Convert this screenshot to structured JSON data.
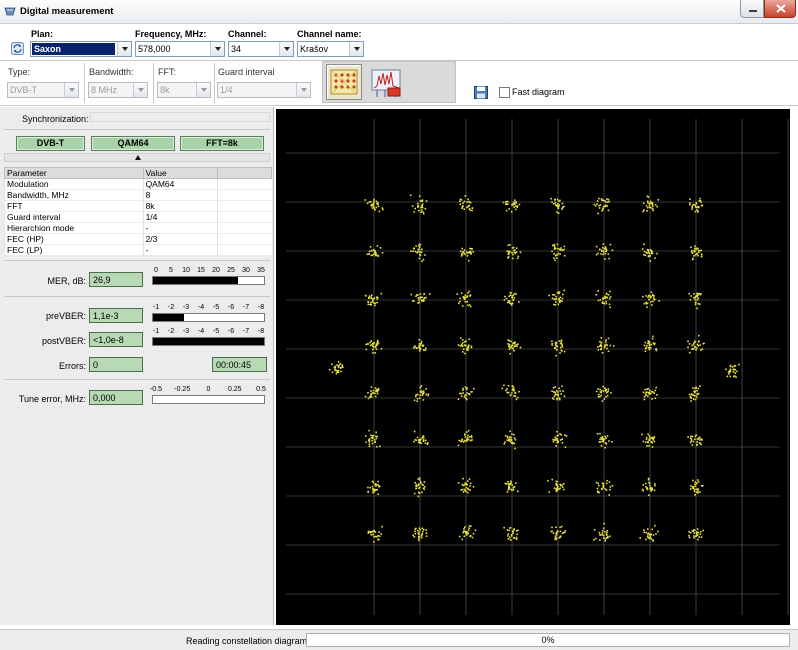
{
  "window": {
    "title": "Digital measurement"
  },
  "top": {
    "plan": {
      "label": "Plan:",
      "value": "Saxon"
    },
    "frequency": {
      "label": "Frequency,  MHz:",
      "value": "578,000"
    },
    "channel": {
      "label": "Channel:",
      "value": "34"
    },
    "channel_name": {
      "label": "Channel name:",
      "value": "Krašov"
    }
  },
  "settings": {
    "type": {
      "label": "Type:",
      "value": "DVB-T"
    },
    "bandwidth": {
      "label": "Bandwidth:",
      "value": "8 MHz"
    },
    "fft": {
      "label": "FFT:",
      "value": "8k"
    },
    "guard": {
      "label": "Guard interval",
      "value": "1/4"
    }
  },
  "fast_diagram": {
    "label": "Fast diagram",
    "checked": false
  },
  "sync": {
    "label": "Synchronization:"
  },
  "status": {
    "standard": "DVB-T",
    "modulation": "QAM64",
    "fft": "FFT=8k"
  },
  "table": {
    "headers": [
      "Parameter",
      "Value",
      ""
    ],
    "rows": [
      [
        "Modulation",
        "QAM64"
      ],
      [
        "Bandwidth, MHz",
        "8"
      ],
      [
        "FFT",
        "8k"
      ],
      [
        "Guard interval",
        "1/4"
      ],
      [
        "Hierarchion mode",
        "-"
      ],
      [
        "FEC (HP)",
        "2/3"
      ],
      [
        "FEC (LP)",
        "-"
      ]
    ]
  },
  "mer": {
    "label": "MER, dB:",
    "value": "26,9",
    "ticks": [
      "0",
      "5",
      "10",
      "15",
      "20",
      "25",
      "30",
      "35"
    ],
    "level": 26.9,
    "max": 35
  },
  "prevber": {
    "label": "preVBER:",
    "value": "1,1e-3",
    "ticks": [
      "-1",
      "-2",
      "-3",
      "-4",
      "-5",
      "-6",
      "-7",
      "-8"
    ],
    "level_fraction": 0.28
  },
  "postvber": {
    "label": "postVBER:",
    "value": "<1,0e-8",
    "ticks": [
      "-1",
      "-2",
      "-3",
      "-4",
      "-5",
      "-6",
      "-7",
      "-8"
    ],
    "level_fraction": 1.0
  },
  "errors": {
    "label": "Errors:",
    "value": "0",
    "time": "00:00:45"
  },
  "tune": {
    "label": "Tune error, MHz:",
    "value": "0,000",
    "ticks": [
      "-0.5",
      "-0.25",
      "0",
      "0.25",
      "0.5"
    ]
  },
  "statusbar": {
    "text": "Reading constellation diagram",
    "progress": "0%"
  },
  "colors": {
    "constellation": "#e8e040",
    "panel_green": "#b7dab5"
  },
  "icons": [
    "digital-measurement-icon",
    "refresh-icon",
    "constellation-icon",
    "spectrum-icon",
    "save-icon"
  ]
}
